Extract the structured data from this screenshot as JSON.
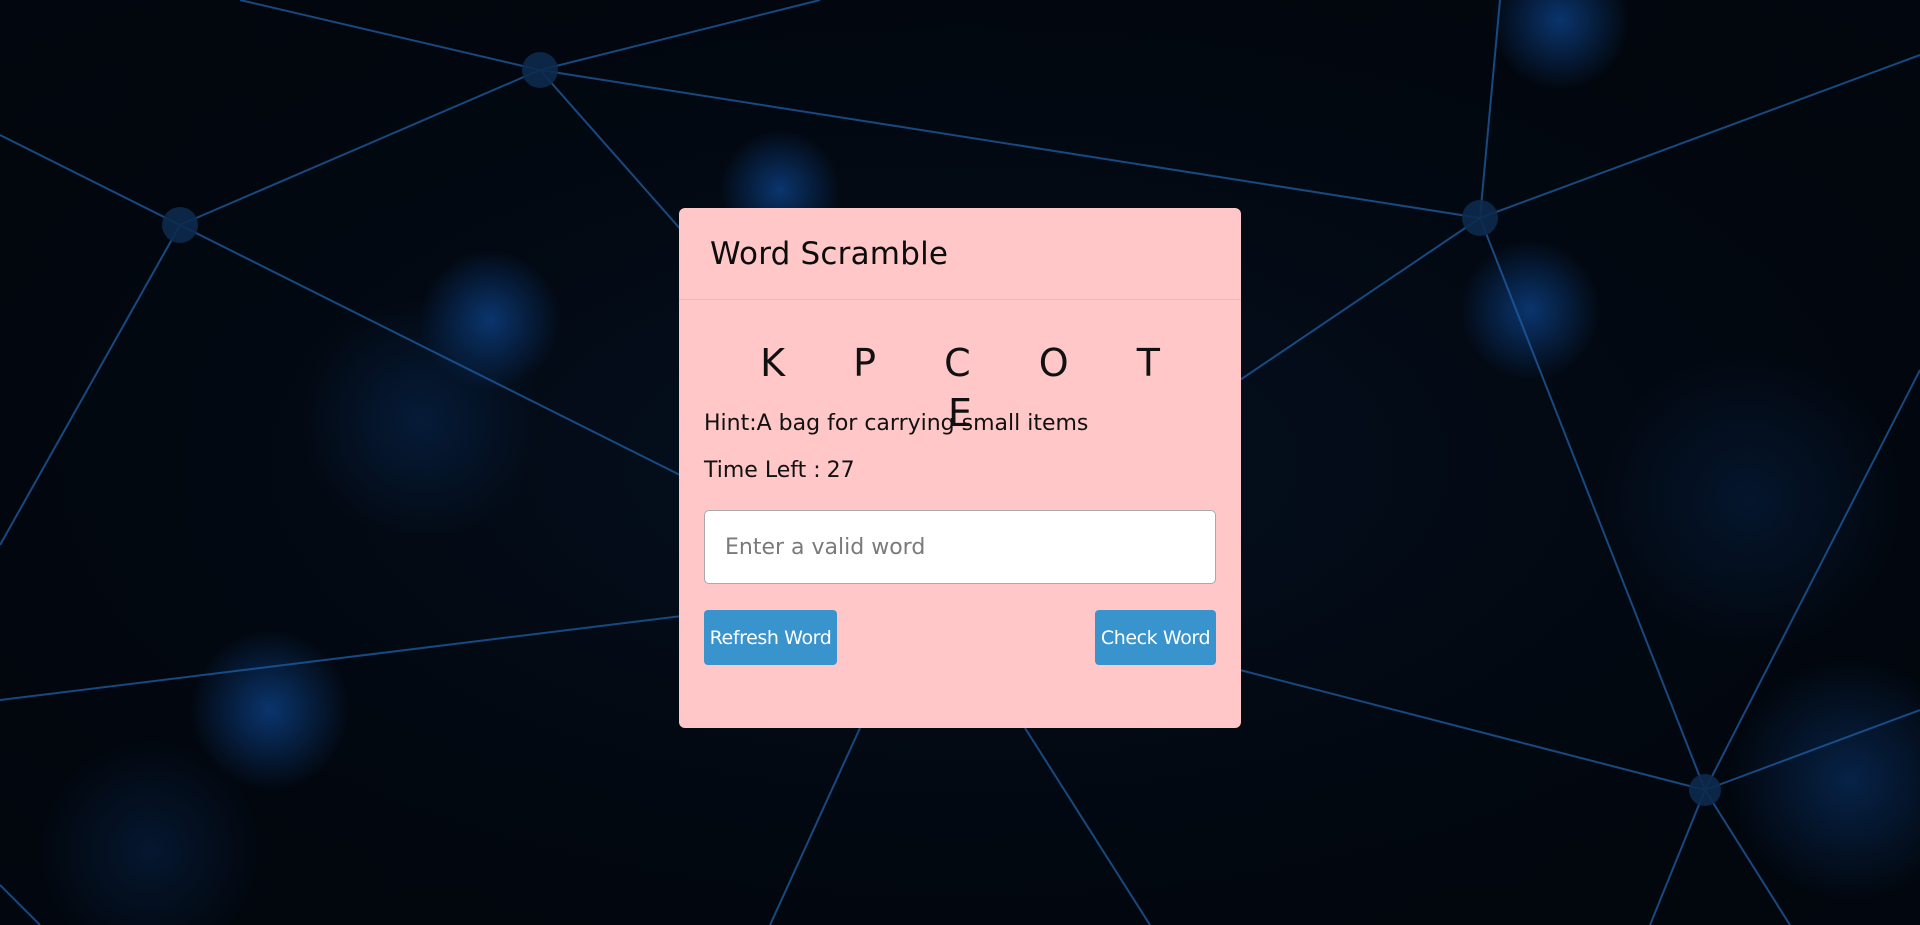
{
  "game": {
    "title": "Word Scramble",
    "scrambled_word": "K P C O T E",
    "hint": "Hint:A bag for carrying small items",
    "time_label": "Time Left :",
    "time_value": "27",
    "input_placeholder": "Enter a valid word",
    "input_value": "",
    "refresh_label": "Refresh Word",
    "check_label": "Check Word"
  },
  "colors": {
    "card_background": "#ffc7c7",
    "button": "#3994cd",
    "page_background": "#02070f",
    "network_lines": "#1f5fa6"
  }
}
